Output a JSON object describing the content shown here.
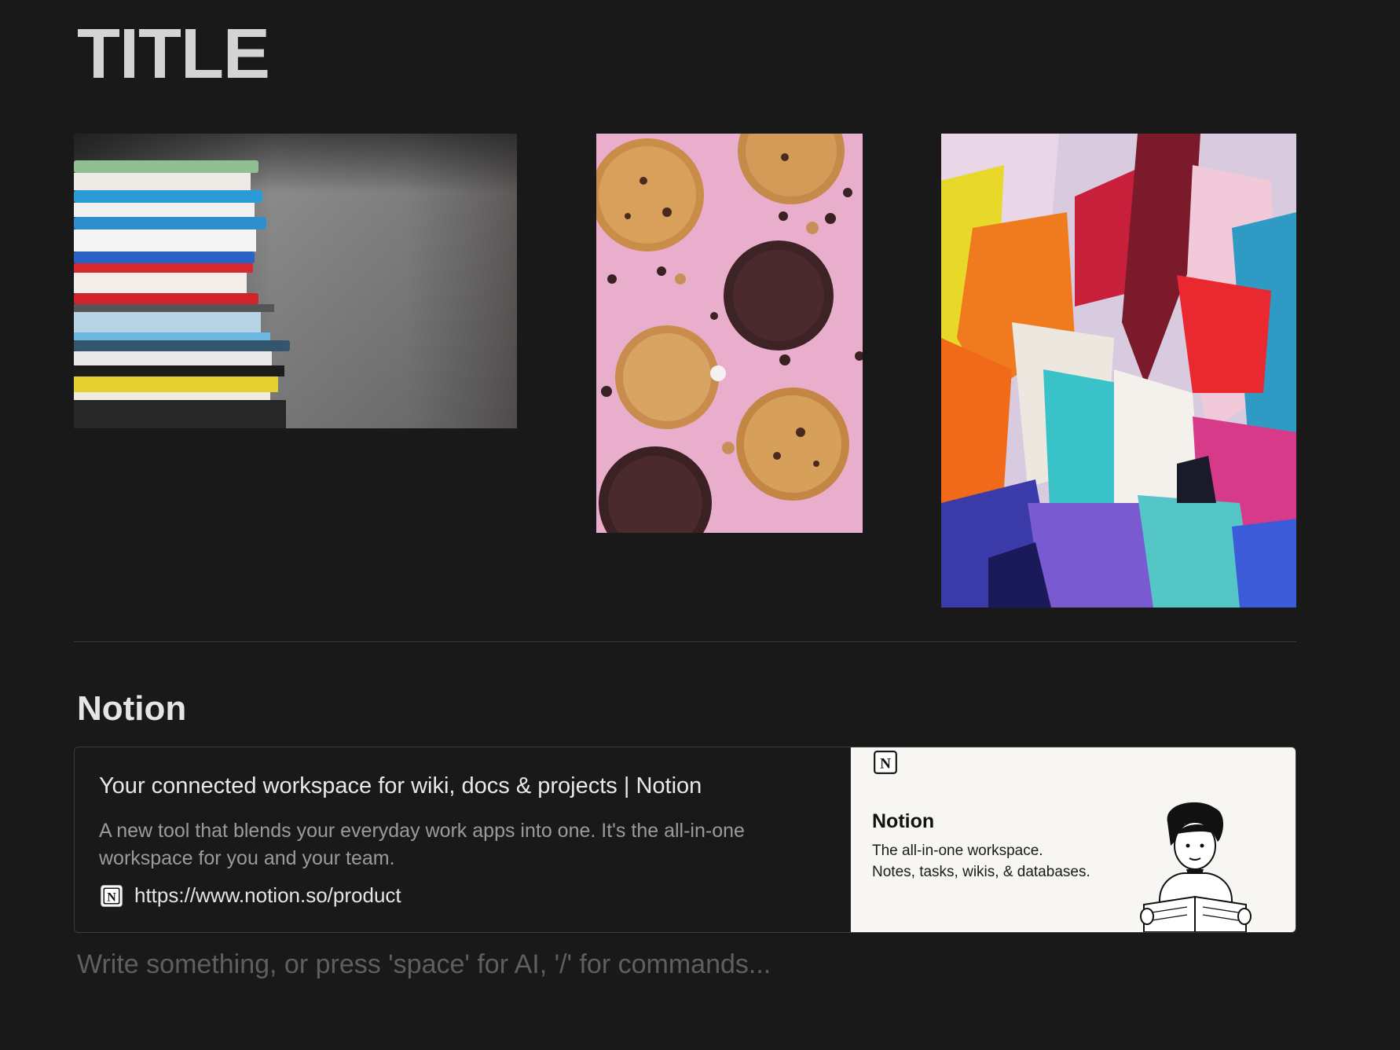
{
  "page": {
    "title": "TITLE"
  },
  "gallery": {
    "images": [
      {
        "subject": "stack of colorful books"
      },
      {
        "subject": "cookies on pink background"
      },
      {
        "subject": "colorful abstract paint texture"
      }
    ]
  },
  "section": {
    "heading": "Notion"
  },
  "bookmark": {
    "title": "Your connected workspace for wiki, docs & projects | Notion",
    "description": "A new tool that blends your everyday work apps into one. It's the all-in-one workspace for you and your team.",
    "url": "https://www.notion.so/product",
    "favicon": "notion-logo-icon",
    "preview": {
      "title": "Notion",
      "line1": "The all-in-one workspace.",
      "line2": "Notes, tasks, wikis, & databases."
    }
  },
  "editor": {
    "placeholder": "Write something, or press 'space' for AI, '/' for commands..."
  },
  "colors": {
    "background": "#191919",
    "text": "#e8e8e6",
    "muted": "#9b9b9b",
    "placeholder": "#5f5f5f",
    "preview_bg": "#f7f6f3"
  }
}
